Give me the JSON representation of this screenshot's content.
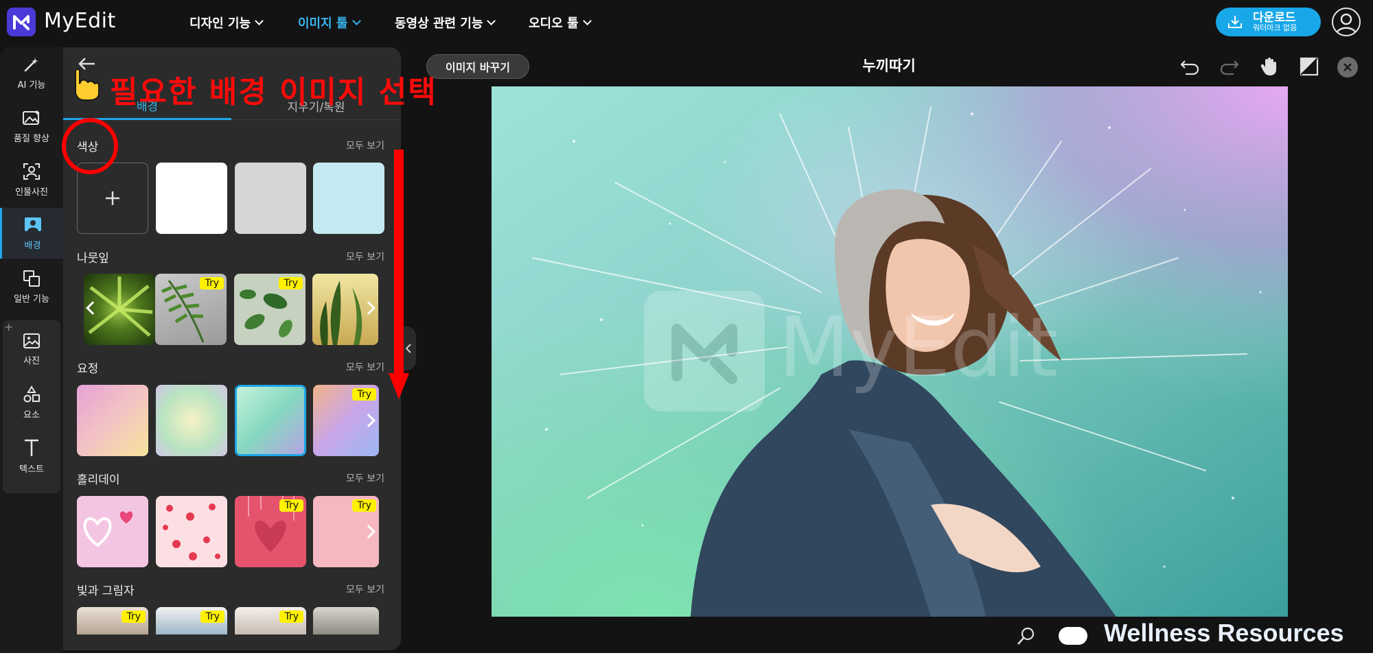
{
  "header": {
    "logo_text": "MyEdit",
    "nav": [
      {
        "label": "디자인 기능",
        "active": false
      },
      {
        "label": "이미지 툴",
        "active": true
      },
      {
        "label": "동영상 관련 기능",
        "active": false
      },
      {
        "label": "오디오 툴",
        "active": false
      }
    ],
    "download": {
      "label": "다운로드",
      "sublabel": "워터마크 없음"
    },
    "accent_color": "#1ea6e8"
  },
  "sidebar": {
    "items": [
      {
        "label": "AI 기능",
        "icon": "magic-wand-icon"
      },
      {
        "label": "품질 향상",
        "icon": "image-enhance-icon"
      },
      {
        "label": "인물사진",
        "icon": "portrait-icon"
      },
      {
        "label": "배경",
        "icon": "background-icon",
        "active": true
      },
      {
        "label": "일반 기능",
        "icon": "layers-icon"
      },
      {
        "label": "사진",
        "icon": "photo-icon"
      },
      {
        "label": "요소",
        "icon": "shapes-icon"
      },
      {
        "label": "텍스트",
        "icon": "text-icon"
      }
    ]
  },
  "panel": {
    "tabs": [
      {
        "label": "배경",
        "active": true
      },
      {
        "label": "지우기/복원",
        "active": false
      }
    ],
    "see_all": "모두 보기",
    "try_label": "Try",
    "sections": [
      {
        "title": "색상"
      },
      {
        "title": "나뭇잎"
      },
      {
        "title": "요정"
      },
      {
        "title": "홀리데이"
      },
      {
        "title": "빛과 그림자"
      }
    ],
    "colors": [
      "#ffffff",
      "#d6d6d6",
      "#c4e9f1"
    ]
  },
  "editor": {
    "replace_button": "이미지 바꾸기",
    "title": "누끼따기",
    "watermark": "MyEdit"
  },
  "annotations": {
    "instruction": "필요한 배경 이미지 선택",
    "color": "#ff0000"
  },
  "footer": {
    "text": "Wellness Resources"
  }
}
